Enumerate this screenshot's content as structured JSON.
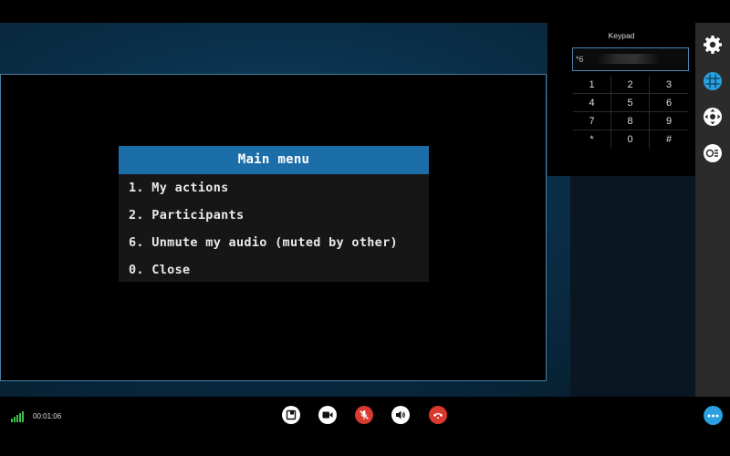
{
  "keypad": {
    "title": "Keypad",
    "input_value": "*6",
    "keys": [
      "1",
      "2",
      "3",
      "4",
      "5",
      "6",
      "7",
      "8",
      "9",
      "*",
      "0",
      "#"
    ]
  },
  "menu": {
    "title": "Main menu",
    "items": [
      "1. My actions",
      "2. Participants",
      "6. Unmute my audio (muted by other)",
      "0. Close"
    ]
  },
  "call": {
    "duration": "00:01:06"
  },
  "sidebar": {
    "icons": [
      "settings-icon",
      "keypad-icon",
      "camera-control-icon",
      "layout-icon"
    ]
  },
  "controls": {
    "icons": [
      "share-icon",
      "video-icon",
      "mic-muted-icon",
      "speaker-icon",
      "hangup-icon",
      "more-icon"
    ]
  },
  "colors": {
    "accent": "#1c6ea8",
    "hangup": "#d93a2e",
    "muted": "#d93a2e",
    "more": "#2aa0e0"
  }
}
